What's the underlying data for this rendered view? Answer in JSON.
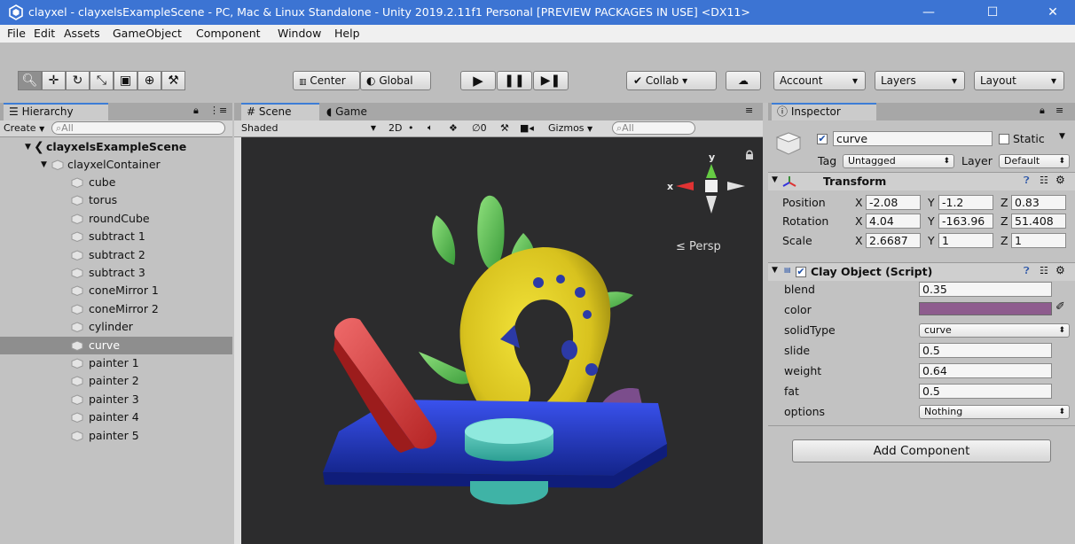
{
  "window": {
    "title": "clayxel - clayxelsExampleScene - PC, Mac & Linux Standalone - Unity 2019.2.11f1 Personal [PREVIEW PACKAGES IN USE] <DX11>",
    "minimize": "—",
    "maximize": "☐",
    "close": "✕"
  },
  "menu": [
    "File",
    "Edit",
    "Assets",
    "GameObject",
    "Component",
    "Window",
    "Help"
  ],
  "toolbar": {
    "pivot_center": "Center",
    "pivot_global": "Global",
    "collab": "Collab",
    "account": "Account",
    "layers": "Layers",
    "layout": "Layout",
    "dropdown_arrow": "▾"
  },
  "hierarchy": {
    "tab": "Hierarchy",
    "create": "Create",
    "search_placeholder": "All",
    "scene_name": "clayxelsExampleScene",
    "container": "clayxelContainer",
    "items": [
      "cube",
      "torus",
      "roundCube",
      "subtract 1",
      "subtract 2",
      "subtract 3",
      "coneMirror 1",
      "coneMirror 2",
      "cylinder",
      "curve",
      "painter 1",
      "painter 2",
      "painter 3",
      "painter 4",
      "painter 5"
    ],
    "selected_index": 9
  },
  "scene": {
    "tab_scene": "Scene",
    "tab_game": "Game",
    "shading": "Shaded",
    "mode_2d": "2D",
    "hidden_count": "0",
    "gizmos": "Gizmos",
    "search_placeholder": "All",
    "persp": "Persp",
    "axis_y": "y",
    "axis_x": "x"
  },
  "inspector": {
    "tab": "Inspector",
    "object_name": "curve",
    "static_label": "Static",
    "tag_label": "Tag",
    "tag_value": "Untagged",
    "layer_label": "Layer",
    "layer_value": "Default",
    "transform": {
      "title": "Transform",
      "position_label": "Position",
      "rotation_label": "Rotation",
      "scale_label": "Scale",
      "position": {
        "x": "-2.08",
        "y": "-1.2",
        "z": "0.83"
      },
      "rotation": {
        "x": "4.04",
        "y": "-163.96",
        "z": "51.408"
      },
      "scale": {
        "x": "2.6687",
        "y": "1",
        "z": "1"
      }
    },
    "clay_object": {
      "title": "Clay Object (Script)",
      "blend_label": "blend",
      "blend": "0.35",
      "color_label": "color",
      "color_value": "#8e5c8e",
      "solidtype_label": "solidType",
      "solidtype": "curve",
      "slide_label": "slide",
      "slide": "0.5",
      "weight_label": "weight",
      "weight": "0.64",
      "fat_label": "fat",
      "fat": "0.5",
      "options_label": "options",
      "options": "Nothing"
    },
    "add_component": "Add Component"
  },
  "axis": {
    "x": "X",
    "y": "Y",
    "z": "Z"
  },
  "colors": {
    "title_bar": "#3c74d3",
    "selection": "#8e8e8e",
    "tab_accent": "#3d7dd6"
  }
}
